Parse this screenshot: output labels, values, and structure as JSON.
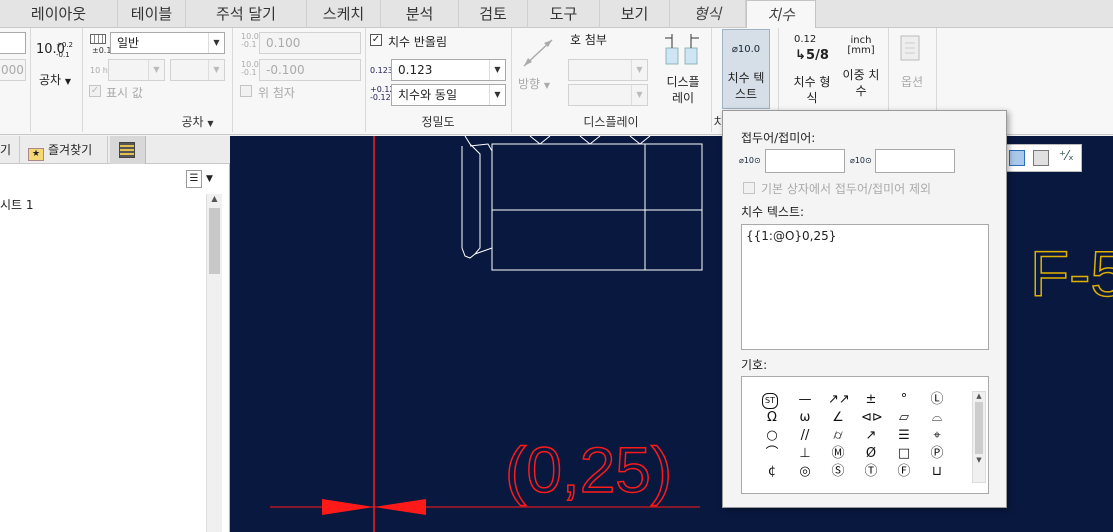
{
  "tabs": [
    {
      "label": "레이아웃",
      "style": "normal"
    },
    {
      "label": "테이블",
      "style": "normal"
    },
    {
      "label": "주석 달기",
      "style": "normal"
    },
    {
      "label": "스케치",
      "style": "normal"
    },
    {
      "label": "분석",
      "style": "normal"
    },
    {
      "label": "검토",
      "style": "normal"
    },
    {
      "label": "도구",
      "style": "normal"
    },
    {
      "label": "보기",
      "style": "normal"
    },
    {
      "label": "형식",
      "style": "italic"
    },
    {
      "label": "치수",
      "style": "active"
    }
  ],
  "ribbon": {
    "tolerance": {
      "tolerance_label": "공차",
      "tol_icon_main": "10.0",
      "tol_icon_upper": "+0.2",
      "tol_icon_lower": "-0.1",
      "std_icon_text": "±0.1",
      "std_value": "일반",
      "fit_icon_text": "10 h7",
      "show_value_label": "표시 값",
      "upper_value": "0.100",
      "lower_value": "-0.100",
      "superscript_label": "위 첨자",
      "group_label": "공차",
      "partial_value": "000",
      "precision_icon_upper": "10.0+0.2",
      "precision_icon_lower": "-0.1"
    },
    "precision": {
      "rounding_label": "치수 반올림",
      "icon_123": "0.123",
      "value": "0.123",
      "icon_pm_upper": "+0.123",
      "icon_pm_lower": "-0.123",
      "tol_precision": "치수와 동일",
      "group_label": "정밀도"
    },
    "display": {
      "direction_label": "방향",
      "arc_label": "호 첨부",
      "display_btn_line1": "디스플",
      "display_btn_line2": "레이",
      "group_label": "디스플레이"
    },
    "dimtext": {
      "icon_text": "⌀10.0",
      "line1": "치수 텍",
      "line2": "스트",
      "group_label_partial": "치"
    },
    "format": {
      "icon_top": "0.12",
      "icon_bottom": "5/8",
      "line1": "치수 형",
      "line2": "식"
    },
    "dual": {
      "icon_top": "inch",
      "icon_bottom": "[mm]",
      "line1": "이중 치",
      "line2": "수"
    },
    "options": {
      "label": "옵션"
    }
  },
  "left_panel": {
    "tab_partial": "기",
    "tab_favorites": "즐겨찾기",
    "tree_item": "시트 1"
  },
  "popup": {
    "prefix_label": "접두어/접미어:",
    "prefix_icon": "⌀10⊙",
    "suffix_icon": "⌀10⊙",
    "prefix_value": "",
    "suffix_value": "",
    "exclude_label": "기본 상자에서 접두어/접미어 제외",
    "dimtext_label": "치수 텍스트:",
    "dimtext_value": "{{1:@O}0,25}",
    "symbols_label": "기호:",
    "symbols": [
      [
        "ST",
        "—",
        "↗↗",
        "±",
        "°",
        "Ⓛ"
      ],
      [
        "Ω",
        "ω",
        "∠",
        "⊲⊳",
        "▱",
        "⌓"
      ],
      [
        "○",
        "//",
        "⌭",
        "↗",
        "☰",
        "⌖"
      ],
      [
        "⌒",
        "⊥",
        "Ⓜ",
        "Ø",
        "□",
        "Ⓟ"
      ],
      [
        "¢",
        "◎",
        "Ⓢ",
        "Ⓣ",
        "Ⓕ",
        "⊔"
      ]
    ]
  },
  "canvas": {
    "dim_text": "(0,25)",
    "label_text": "F-5",
    "line_color": "#ffffff",
    "dim_color": "#ff1a1a",
    "label_color": "#e0b000",
    "background": "#08183f"
  }
}
